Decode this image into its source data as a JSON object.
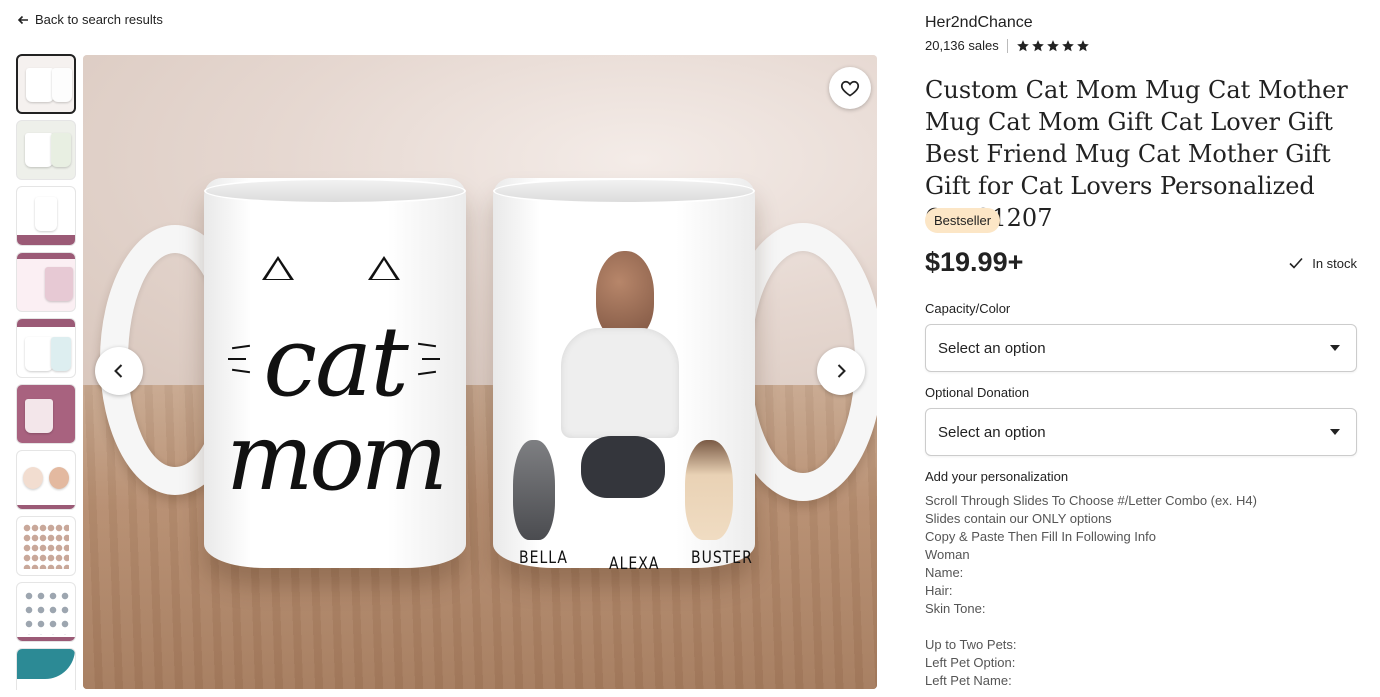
{
  "nav": {
    "back_label": "Back to search results"
  },
  "gallery": {
    "thumbnail_count": 10,
    "active_index": 0,
    "mug_front": {
      "line1": "cat",
      "line2": "mom"
    },
    "pet_names": [
      "BELLA",
      "ALEXA",
      "BUSTER"
    ]
  },
  "shop": {
    "name": "Her2ndChance",
    "sales": "20,136 sales",
    "rating_stars": 5
  },
  "product": {
    "title": "Custom Cat Mom Mug Cat Mother Mug Cat Mom Gift Cat Lover Gift Best Friend Mug Cat Mother Gift Gift for Cat Lovers Personalized Cat S1207",
    "badge": "Bestseller",
    "price": "$19.99+",
    "stock": "In stock"
  },
  "options": [
    {
      "label": "Capacity/Color",
      "value": "Select an option"
    },
    {
      "label": "Optional Donation",
      "value": "Select an option"
    }
  ],
  "personalization": {
    "label": "Add your personalization",
    "lines": [
      "Scroll Through Slides To Choose #/Letter Combo (ex. H4)",
      "Slides contain our ONLY options",
      "Copy & Paste Then Fill In Following Info",
      "Woman",
      "Name:",
      "Hair:",
      "Skin Tone:",
      "",
      "Up to Two Pets:",
      "Left Pet Option:",
      "Left Pet Name:"
    ]
  },
  "colors": {
    "text": "#222222",
    "badge_bg": "#fce6c6",
    "thumb_accent": "#9b5a76"
  }
}
